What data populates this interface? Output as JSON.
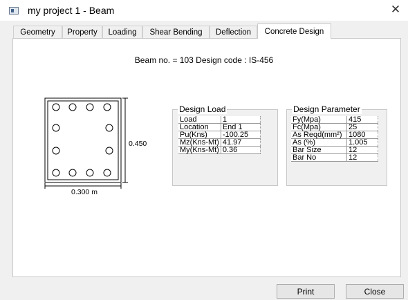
{
  "window": {
    "title": "my project 1 - Beam",
    "close_glyph": "✕"
  },
  "tabs": [
    {
      "label": "Geometry"
    },
    {
      "label": "Property"
    },
    {
      "label": "Loading"
    },
    {
      "label": "Shear Bending"
    },
    {
      "label": "Deflection"
    },
    {
      "label": "Concrete Design",
      "active": true
    }
  ],
  "beam_info": "Beam no. = 103  Design code :  IS-456",
  "section": {
    "depth_label": "0.450",
    "width_label": "0.300 m",
    "bar_count": 12
  },
  "design_load": {
    "title": "Design Load",
    "rows": [
      {
        "key": "Load",
        "value": "1"
      },
      {
        "key": "Location",
        "value": "End 1"
      },
      {
        "key": "Pu(Kns)",
        "value": "-100.25"
      },
      {
        "key": "Mz(Kns-Mt)",
        "value": "41.97"
      },
      {
        "key": "My(Kns-Mt)",
        "value": "0.36"
      }
    ]
  },
  "design_parameter": {
    "title": "Design Parameter",
    "rows": [
      {
        "key": "Fy(Mpa)",
        "value": "415"
      },
      {
        "key": "Fc(Mpa)",
        "value": "25"
      },
      {
        "key": "As Reqd(mm²)",
        "value": "1080"
      },
      {
        "key": "As (%)",
        "value": "1.005"
      },
      {
        "key": "Bar Size",
        "value": "12"
      },
      {
        "key": "Bar No",
        "value": "12"
      }
    ]
  },
  "buttons": {
    "print": "Print",
    "close": "Close"
  }
}
